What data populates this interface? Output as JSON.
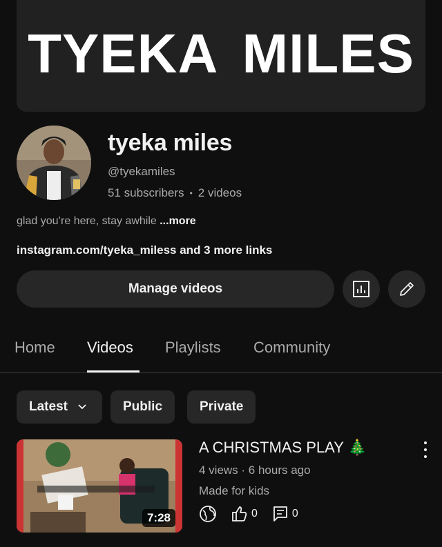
{
  "banner": {
    "text": "TYEKA MILES"
  },
  "channel": {
    "name": "tyeka miles",
    "handle": "@tyekamiles",
    "subscribers": "51 subscribers",
    "separator": "•",
    "videos": "2 videos",
    "description": "glad you’re here, stay awhile ",
    "more_label": "...more",
    "links": "instagram.com/tyeka_miless and 3 more links"
  },
  "actions": {
    "manage_label": "Manage videos",
    "analytics_icon": "analytics-icon",
    "edit_icon": "edit-pencil-icon"
  },
  "tabs": [
    {
      "label": "Home",
      "active": false
    },
    {
      "label": "Videos",
      "active": true
    },
    {
      "label": "Playlists",
      "active": false
    },
    {
      "label": "Community",
      "active": false
    }
  ],
  "filters": {
    "sort_label": "Latest",
    "public_label": "Public",
    "private_label": "Private"
  },
  "video": {
    "title": "A CHRISTMAS PLAY 🎄",
    "meta": "4 views · 6 hours ago",
    "audience": "Made for kids",
    "duration": "7:28",
    "likes": "0",
    "comments": "0",
    "visibility_icon": "globe-icon"
  },
  "colors": {
    "background": "#0f0f0f",
    "surface": "#272727",
    "text_primary": "#f1f1f1",
    "text_secondary": "#aaaaaa"
  }
}
